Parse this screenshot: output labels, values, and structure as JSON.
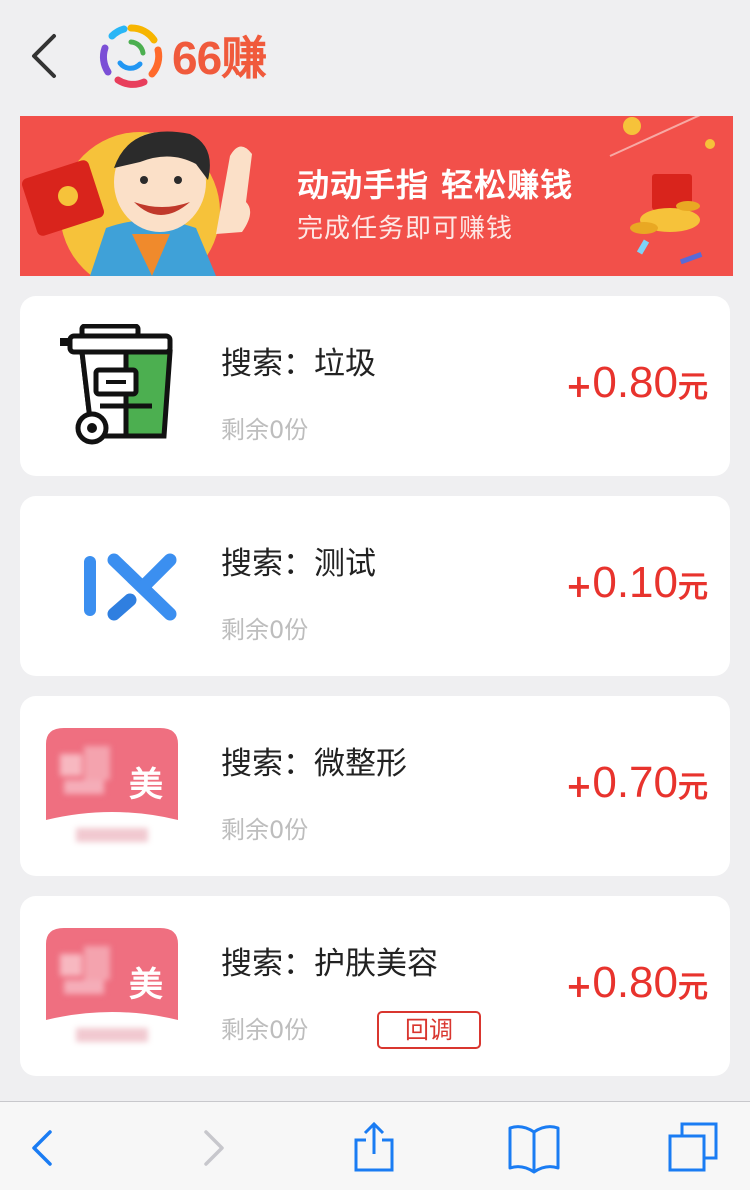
{
  "header": {
    "logo_text": "66赚",
    "icons": {
      "back": "chevron-left-icon",
      "logo": "pinwheel-logo-icon"
    }
  },
  "banner": {
    "title": "动动手指 轻松赚钱",
    "subtitle": "完成任务即可赚钱",
    "background_color": "#f2504a"
  },
  "tasks": [
    {
      "title": "搜索：垃圾",
      "remaining": "剩余0份",
      "plus": "+",
      "amount": "0.80",
      "unit": "元",
      "icon": "trash-can-icon"
    },
    {
      "title": "搜索：测试",
      "remaining": "剩余0份",
      "plus": "+",
      "amount": "0.10",
      "unit": "元",
      "icon": "ix-logo-icon"
    },
    {
      "title": "搜索：微整形",
      "remaining": "剩余0份",
      "plus": "+",
      "amount": "0.70",
      "unit": "元",
      "icon": "beauty-app-icon",
      "icon_char": "美"
    },
    {
      "title": "搜索：护肤美容",
      "remaining": "剩余0份",
      "plus": "+",
      "amount": "0.80",
      "unit": "元",
      "icon": "beauty-app-icon",
      "icon_char": "美",
      "tag": "回调"
    }
  ],
  "colors": {
    "accent": "#e8332d",
    "logo": "#f05a3c",
    "toolbar_icon": "#1a7cf3"
  },
  "toolbar": {
    "icons": [
      "back-arrow-icon",
      "forward-arrow-icon",
      "share-icon",
      "bookmarks-icon",
      "tabs-icon"
    ]
  }
}
